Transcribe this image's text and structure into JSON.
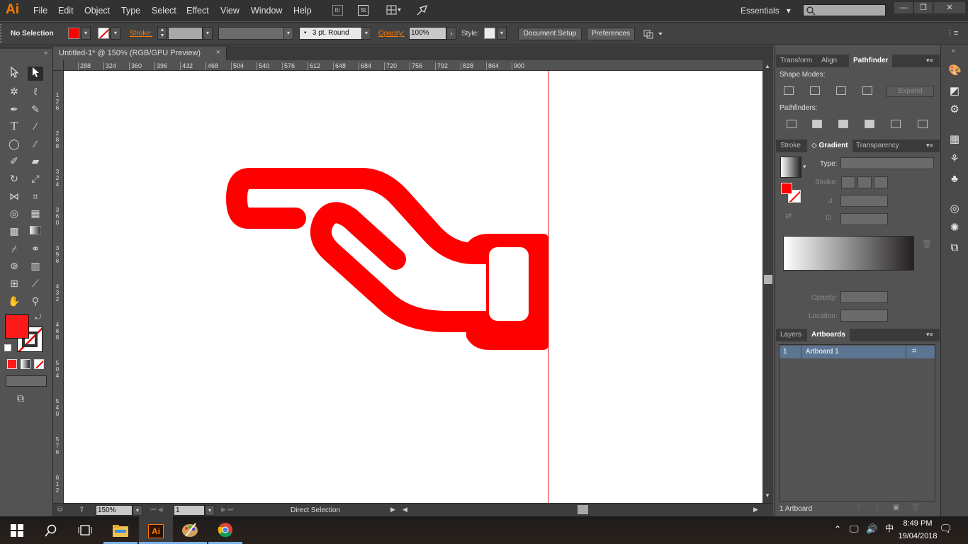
{
  "app": {
    "logo": "Ai"
  },
  "menu": [
    "File",
    "Edit",
    "Object",
    "Type",
    "Select",
    "Effect",
    "View",
    "Window",
    "Help"
  ],
  "toolbar_icons": {
    "bridge": "Br",
    "stock": "St"
  },
  "workspace": {
    "label": "Essentials",
    "arrow": "▾"
  },
  "window_controls": {
    "minimize": "—",
    "restore": "❐",
    "close": "✕"
  },
  "control_bar": {
    "selection_status": "No Selection",
    "fill_color": "#ff0000",
    "stroke_label": "Stroke:",
    "brush_profile": "3 pt. Round",
    "brush_dot": "•",
    "opacity_label": "Opacity:",
    "opacity_value": "100%",
    "style_label": "Style:",
    "document_setup": "Document Setup",
    "preferences": "Preferences",
    "menu_icon": "⋮≡"
  },
  "document": {
    "tab_title": "Untitled-1* @ 150% (RGB/GPU Preview)",
    "close": "×"
  },
  "rulers": {
    "horizontal": [
      "288",
      "324",
      "360",
      "396",
      "432",
      "468",
      "504",
      "540",
      "576",
      "612",
      "648",
      "684",
      "720",
      "756",
      "792",
      "828",
      "864",
      "900"
    ],
    "vertical": [
      "126",
      "288",
      "324",
      "360",
      "396",
      "432",
      "468",
      "504",
      "540",
      "576",
      "612"
    ]
  },
  "status_bar": {
    "zoom": "150%",
    "artboard_number": "1",
    "current_tool": "Direct Selection"
  },
  "panels": {
    "top_tabs": [
      "Transform",
      "Align",
      "Pathfinder"
    ],
    "shape_modes": "Shape Modes:",
    "pathfinders": "Pathfinders:",
    "expand": "Expand",
    "mid_tabs": [
      "Stroke",
      "Gradient",
      "Transparency"
    ],
    "gradient_arrows": "◇",
    "type_label": "Type:",
    "stroke_label": "Stroke:",
    "opacity_label": "Opacity:",
    "location_label": "Location:",
    "bottom_tabs": [
      "Layers",
      "Artboards"
    ],
    "artboards": [
      {
        "number": "1",
        "name": "Artboard 1"
      }
    ],
    "artboard_count": "1 Artboard"
  },
  "taskbar": {
    "time": "8:49 PM",
    "date": "19/04/2018",
    "ai_label": "Ai"
  },
  "colors": {
    "accent_orange": "#ff7c00",
    "artwork_red": "#ff0000",
    "guide_red": "#e0141c"
  }
}
